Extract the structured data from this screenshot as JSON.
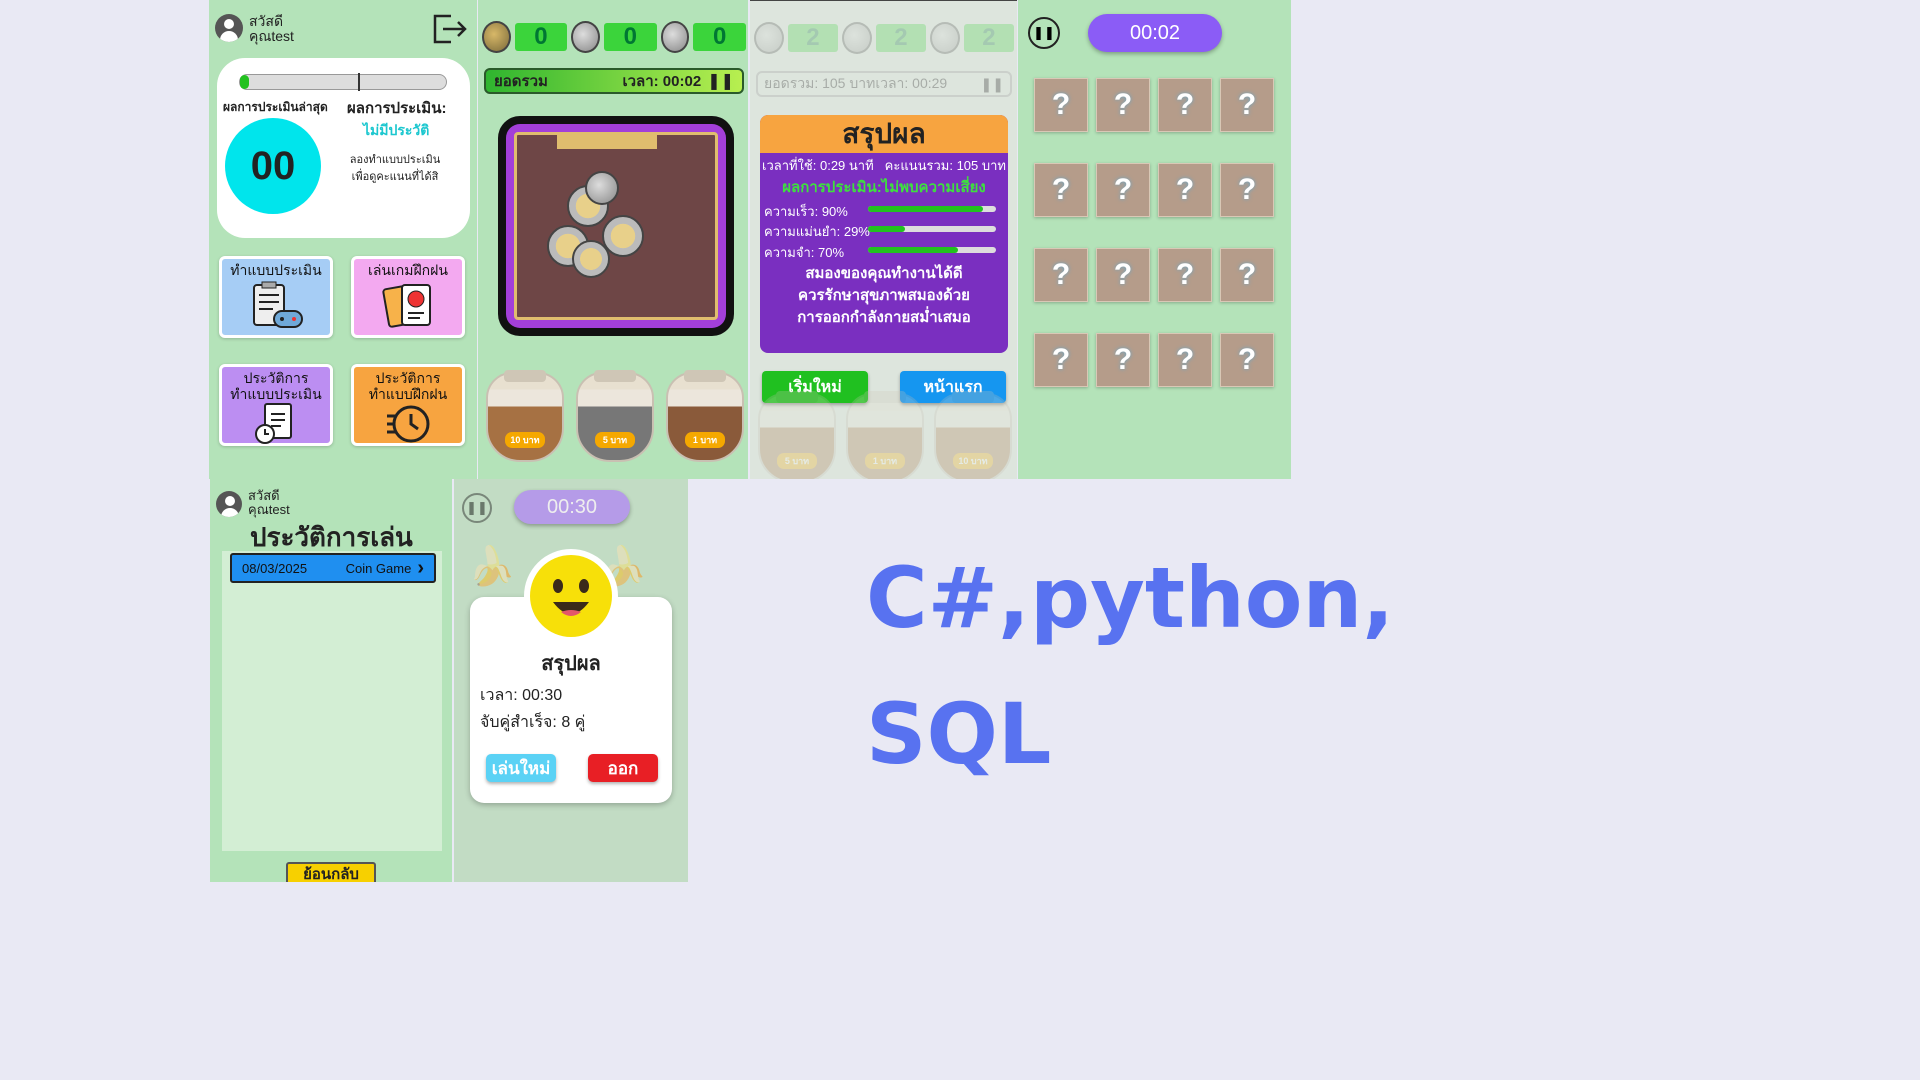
{
  "home": {
    "greeting": "สวัสดี",
    "username": "คุณtest",
    "latest_label": "ผลการประเมินล่าสุด",
    "score": "00",
    "result_label": "ผลการประเมิน:",
    "result_value": "ไม่มีประวัติ",
    "hint_line1": "ลองทำแบบประเมิน",
    "hint_line2": "เพื่อดูคะแนนที่ได้สิ",
    "tile_assessment": "ทำแบบประเมิน",
    "tile_practice": "เล่นเกมฝึกฝน",
    "tile_history_assessment_1": "ประวัติการ",
    "tile_history_assessment_2": "ทำแบบประเมิน",
    "tile_history_practice_1": "ประวัติการ",
    "tile_history_practice_2": "ทำแบบฝึกฝน"
  },
  "coin_game": {
    "counts": [
      "0",
      "0",
      "0"
    ],
    "total_label": "ยอดรวม",
    "time_label": "เวลา: 00:02",
    "jars": [
      "10 บาท",
      "5 บาท",
      "1 บาท"
    ]
  },
  "coin_result": {
    "faded_counts": [
      "2",
      "2",
      "2"
    ],
    "faded_bar": "ยอดรวม: 105 บาทเวลา: 00:29",
    "title": "สรุปผล",
    "time_used": "เวลาที่ใช้: 0:29 นาที",
    "total_score": "คะแนนรวม: 105 บาท",
    "assessment": "ผลการประเมิน:ไม่พบความเสี่ยง",
    "metrics": [
      {
        "label": "ความเร็ว: 90%",
        "value": 0.9
      },
      {
        "label": "ความแม่นยำ: 29%",
        "value": 0.29
      },
      {
        "label": "ความจำ: 70%",
        "value": 0.7
      }
    ],
    "advice_1": "สมองของคุณทำงานได้ดี",
    "advice_2": "ควรรักษาสุขภาพสมองด้วย",
    "advice_3": "การออกกำลังกายสม่ำเสมอ",
    "restart_button": "เริ่มใหม่",
    "home_button": "หน้าแรก",
    "faded_jars": [
      "5 บาท",
      "1 บาท",
      "10 บาท"
    ]
  },
  "memory_game": {
    "timer": "00:02",
    "card_symbol": "?"
  },
  "history": {
    "greeting": "สวัสดี",
    "username": "คุณtest",
    "title": "ประวัติการเล่น",
    "entry_date": "08/03/2025",
    "entry_game": "Coin Game",
    "back_button": "ย้อนกลับ"
  },
  "match_result": {
    "timer": "00:30",
    "title": "สรุปผล",
    "time_line": "เวลา: 00:30",
    "pairs_line": "จับคู่สำเร็จ: 8 คู่",
    "replay_button": "เล่นใหม่",
    "exit_button": "ออก"
  },
  "tech_stack": {
    "line1": "C#,python,",
    "line2": "SQL"
  },
  "colors": {
    "panel_bg": "#b4e3b9",
    "page_bg": "#e9e9f4",
    "accent_purple": "#7a2fc0",
    "accent_orange": "#f7a440",
    "score_cyan": "#00e5ec",
    "tech_text": "#5872f0"
  }
}
